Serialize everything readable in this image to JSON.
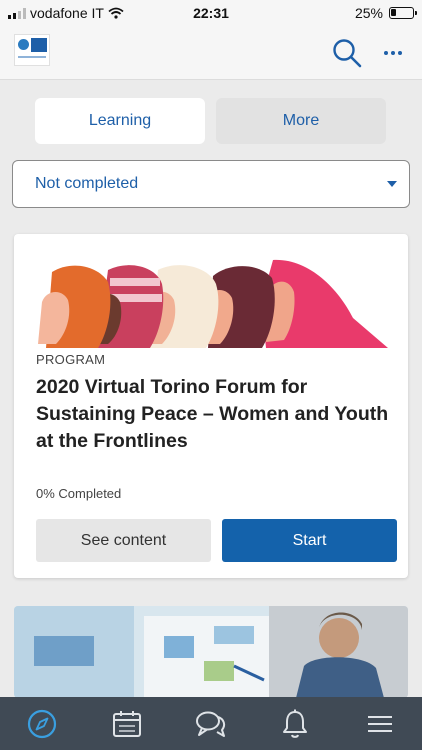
{
  "status_bar": {
    "carrier": "vodafone IT",
    "time": "22:31",
    "battery": "25%"
  },
  "header": {
    "logo_icon": "un-logo",
    "search_icon": "search-icon",
    "more_icon": "more-icon"
  },
  "tabs": [
    {
      "label": "Learning",
      "active": true
    },
    {
      "label": "More",
      "active": false
    }
  ],
  "filter": {
    "selected": "Not completed"
  },
  "card": {
    "type": "PROGRAM",
    "title": "2020 Virtual Torino Forum for Sustaining Peace – Women and Youth at the Frontlines",
    "progress_text": "0% Completed",
    "progress": 0,
    "see_content_label": "See content",
    "start_label": "Start"
  },
  "bottom_nav": [
    {
      "icon": "compass-icon",
      "active": true
    },
    {
      "icon": "calendar-icon",
      "active": false
    },
    {
      "icon": "chat-icon",
      "active": false
    },
    {
      "icon": "bell-icon",
      "active": false
    },
    {
      "icon": "menu-icon",
      "active": false
    }
  ],
  "colors": {
    "accent": "#1e5fa8",
    "primary_button": "#1462ab",
    "nav_background": "#404a55",
    "active_nav_icon": "#3a9fe0"
  }
}
